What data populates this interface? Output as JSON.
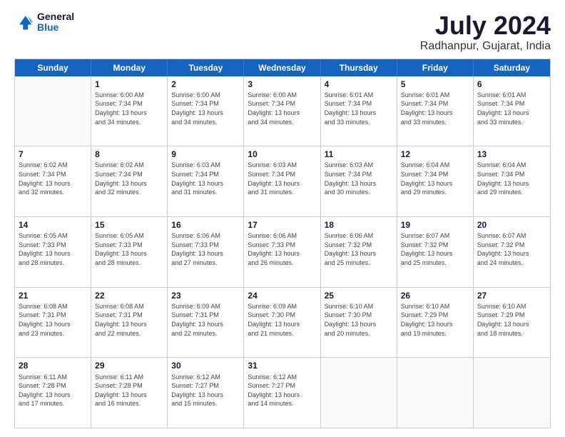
{
  "logo": {
    "general": "General",
    "blue": "Blue"
  },
  "title": "July 2024",
  "subtitle": "Radhanpur, Gujarat, India",
  "header_days": [
    "Sunday",
    "Monday",
    "Tuesday",
    "Wednesday",
    "Thursday",
    "Friday",
    "Saturday"
  ],
  "weeks": [
    [
      {
        "day": "",
        "text": ""
      },
      {
        "day": "1",
        "text": "Sunrise: 6:00 AM\nSunset: 7:34 PM\nDaylight: 13 hours\nand 34 minutes."
      },
      {
        "day": "2",
        "text": "Sunrise: 6:00 AM\nSunset: 7:34 PM\nDaylight: 13 hours\nand 34 minutes."
      },
      {
        "day": "3",
        "text": "Sunrise: 6:00 AM\nSunset: 7:34 PM\nDaylight: 13 hours\nand 34 minutes."
      },
      {
        "day": "4",
        "text": "Sunrise: 6:01 AM\nSunset: 7:34 PM\nDaylight: 13 hours\nand 33 minutes."
      },
      {
        "day": "5",
        "text": "Sunrise: 6:01 AM\nSunset: 7:34 PM\nDaylight: 13 hours\nand 33 minutes."
      },
      {
        "day": "6",
        "text": "Sunrise: 6:01 AM\nSunset: 7:34 PM\nDaylight: 13 hours\nand 33 minutes."
      }
    ],
    [
      {
        "day": "7",
        "text": "Sunrise: 6:02 AM\nSunset: 7:34 PM\nDaylight: 13 hours\nand 32 minutes."
      },
      {
        "day": "8",
        "text": "Sunrise: 6:02 AM\nSunset: 7:34 PM\nDaylight: 13 hours\nand 32 minutes."
      },
      {
        "day": "9",
        "text": "Sunrise: 6:03 AM\nSunset: 7:34 PM\nDaylight: 13 hours\nand 31 minutes."
      },
      {
        "day": "10",
        "text": "Sunrise: 6:03 AM\nSunset: 7:34 PM\nDaylight: 13 hours\nand 31 minutes."
      },
      {
        "day": "11",
        "text": "Sunrise: 6:03 AM\nSunset: 7:34 PM\nDaylight: 13 hours\nand 30 minutes."
      },
      {
        "day": "12",
        "text": "Sunrise: 6:04 AM\nSunset: 7:34 PM\nDaylight: 13 hours\nand 29 minutes."
      },
      {
        "day": "13",
        "text": "Sunrise: 6:04 AM\nSunset: 7:34 PM\nDaylight: 13 hours\nand 29 minutes."
      }
    ],
    [
      {
        "day": "14",
        "text": "Sunrise: 6:05 AM\nSunset: 7:33 PM\nDaylight: 13 hours\nand 28 minutes."
      },
      {
        "day": "15",
        "text": "Sunrise: 6:05 AM\nSunset: 7:33 PM\nDaylight: 13 hours\nand 28 minutes."
      },
      {
        "day": "16",
        "text": "Sunrise: 6:06 AM\nSunset: 7:33 PM\nDaylight: 13 hours\nand 27 minutes."
      },
      {
        "day": "17",
        "text": "Sunrise: 6:06 AM\nSunset: 7:33 PM\nDaylight: 13 hours\nand 26 minutes."
      },
      {
        "day": "18",
        "text": "Sunrise: 6:06 AM\nSunset: 7:32 PM\nDaylight: 13 hours\nand 25 minutes."
      },
      {
        "day": "19",
        "text": "Sunrise: 6:07 AM\nSunset: 7:32 PM\nDaylight: 13 hours\nand 25 minutes."
      },
      {
        "day": "20",
        "text": "Sunrise: 6:07 AM\nSunset: 7:32 PM\nDaylight: 13 hours\nand 24 minutes."
      }
    ],
    [
      {
        "day": "21",
        "text": "Sunrise: 6:08 AM\nSunset: 7:31 PM\nDaylight: 13 hours\nand 23 minutes."
      },
      {
        "day": "22",
        "text": "Sunrise: 6:08 AM\nSunset: 7:31 PM\nDaylight: 13 hours\nand 22 minutes."
      },
      {
        "day": "23",
        "text": "Sunrise: 6:09 AM\nSunset: 7:31 PM\nDaylight: 13 hours\nand 22 minutes."
      },
      {
        "day": "24",
        "text": "Sunrise: 6:09 AM\nSunset: 7:30 PM\nDaylight: 13 hours\nand 21 minutes."
      },
      {
        "day": "25",
        "text": "Sunrise: 6:10 AM\nSunset: 7:30 PM\nDaylight: 13 hours\nand 20 minutes."
      },
      {
        "day": "26",
        "text": "Sunrise: 6:10 AM\nSunset: 7:29 PM\nDaylight: 13 hours\nand 19 minutes."
      },
      {
        "day": "27",
        "text": "Sunrise: 6:10 AM\nSunset: 7:29 PM\nDaylight: 13 hours\nand 18 minutes."
      }
    ],
    [
      {
        "day": "28",
        "text": "Sunrise: 6:11 AM\nSunset: 7:28 PM\nDaylight: 13 hours\nand 17 minutes."
      },
      {
        "day": "29",
        "text": "Sunrise: 6:11 AM\nSunset: 7:28 PM\nDaylight: 13 hours\nand 16 minutes."
      },
      {
        "day": "30",
        "text": "Sunrise: 6:12 AM\nSunset: 7:27 PM\nDaylight: 13 hours\nand 15 minutes."
      },
      {
        "day": "31",
        "text": "Sunrise: 6:12 AM\nSunset: 7:27 PM\nDaylight: 13 hours\nand 14 minutes."
      },
      {
        "day": "",
        "text": ""
      },
      {
        "day": "",
        "text": ""
      },
      {
        "day": "",
        "text": ""
      }
    ]
  ]
}
